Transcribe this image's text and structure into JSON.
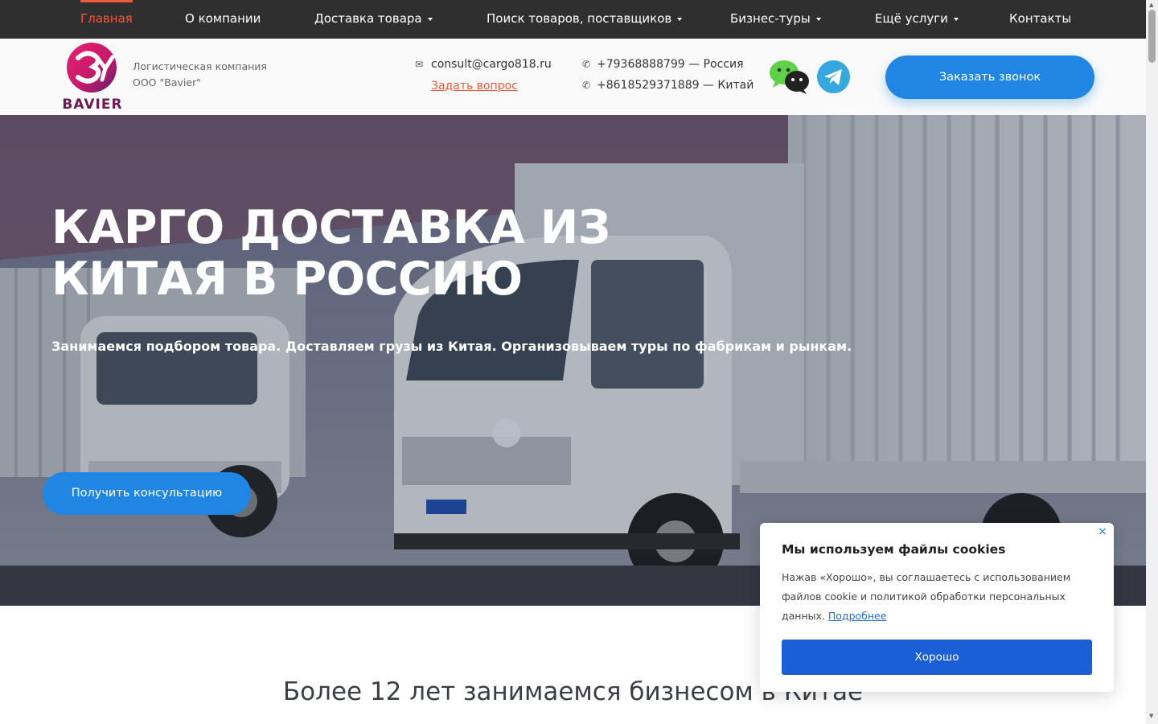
{
  "nav": {
    "items": [
      {
        "label": "Главная",
        "dropdown": false
      },
      {
        "label": "О компании",
        "dropdown": false
      },
      {
        "label": "Доставка товара",
        "dropdown": true
      },
      {
        "label": "Поиск товаров, поставщиков",
        "dropdown": true
      },
      {
        "label": "Бизнес-туры",
        "dropdown": true
      },
      {
        "label": "Ещё услуги",
        "dropdown": true
      },
      {
        "label": "Контакты",
        "dropdown": false
      }
    ],
    "active_index": 0
  },
  "header": {
    "logo_text": "BAVIER",
    "company_line1": "Логистическая компания",
    "company_line2": "ООО \"Bavier\"",
    "email": "consult@cargo818.ru",
    "ask_link": "Задать вопрос",
    "phone_ru": "+79368888799 — Россия",
    "phone_cn": "+8618529371889 — Китай",
    "messengers": [
      "wechat-icon",
      "telegram-icon"
    ],
    "call_button": "Заказать звонок"
  },
  "hero": {
    "title": "КАРГО ДОСТАВКА ИЗ КИТАЯ В РОССИЮ",
    "subtitle": "Занимаемся подбором товара. Доставляем грузы из Китая. Организовываем туры по фабрикам и рынкам.",
    "button": "Получить консультацию"
  },
  "section": {
    "title": "Более 12 лет занимаемся бизнесом в Китае"
  },
  "cookie": {
    "title": "Мы используем файлы cookies",
    "text": "Нажав «Хорошо», вы соглашаетесь с использованием файлов cookie и политикой обработки персональных данных.",
    "more_link": "Подробнее",
    "ok_button": "Хорошо",
    "close": "×"
  },
  "colors": {
    "nav_bg": "#2f2f2f",
    "accent_orange": "#f05a3c",
    "primary_blue": "#1f86e4",
    "cookie_button": "#1a5fd6"
  }
}
